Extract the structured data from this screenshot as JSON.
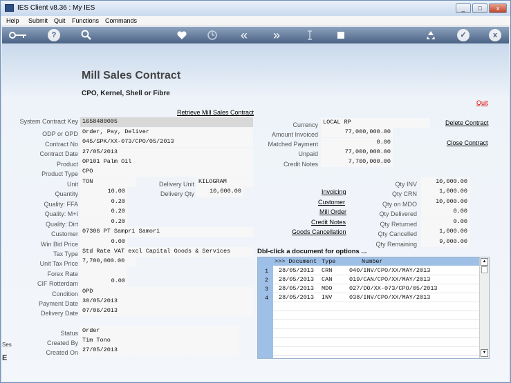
{
  "window": {
    "title": "IES Client v8.36 : My IES",
    "btn_min": "_",
    "btn_max": "□",
    "btn_close": "x"
  },
  "menu": [
    "Help",
    "Submit",
    "Quit",
    "Functions",
    "Commands"
  ],
  "toolbar": {
    "icons": [
      "key-icon",
      "help-icon",
      "search-icon",
      "heart-icon",
      "clock-icon",
      "rewind-icon",
      "forward-icon",
      "text-cursor-icon",
      "stop-icon",
      "recycle-icon",
      "check-icon",
      "close-icon"
    ],
    "help": "?",
    "check": "✓",
    "close": "x",
    "rewind": "«",
    "forward": "»"
  },
  "page": {
    "title": "Mill Sales Contract",
    "subtitle": "CPO, Kernel, Shell or Fibre",
    "quit": "Quit",
    "retrieve": "Retrieve Mill Sales Contract"
  },
  "left_fields": [
    {
      "label": "System Contract Key",
      "value": "1658480005"
    },
    {
      "label": "ODP or OPD",
      "value": "Order, Pay, Deliver"
    },
    {
      "label": "Contract No",
      "value": "045/SPK/XX-073/CPO/05/2013"
    },
    {
      "label": "Contract Date",
      "value": "27/05/2013"
    },
    {
      "label": "Product",
      "value": "OP101 Palm Oil"
    },
    {
      "label": "Product Type",
      "value": "CPO"
    },
    {
      "label": "Unit",
      "value": "TON"
    },
    {
      "label": "Quantity",
      "value": "10.00"
    },
    {
      "label": "Quality: FFA",
      "value": "0.20"
    },
    {
      "label": "Quality: M+I",
      "value": "0.20"
    },
    {
      "label": "Quality: Dirt",
      "value": "0.20"
    },
    {
      "label": "Customer",
      "value": "07306 PT Sampri Samori"
    },
    {
      "label": "Win Bid Price",
      "value": "0.00"
    },
    {
      "label": "Tax Type",
      "value": "Std Rate VAT excl Capital Goods & Services"
    },
    {
      "label": "Unit Tax Price",
      "value": "7,700,000.00"
    },
    {
      "label": "Forex Rate",
      "value": ""
    },
    {
      "label": "CIF Rotterdam",
      "value": "0.00"
    },
    {
      "label": "Condition",
      "value": "OPD"
    },
    {
      "label": "Payment Date",
      "value": "30/05/2013"
    },
    {
      "label": "Delivery Date",
      "value": "07/06/2013"
    }
  ],
  "delivery": {
    "unit_label": "Delivery Unit",
    "unit_value": "KILOGRAM",
    "qty_label": "Delivery Qty",
    "qty_value": "10,000.00"
  },
  "status": [
    {
      "label": "Status",
      "value": "Order"
    },
    {
      "label": "Created By",
      "value": "Tim Tono"
    },
    {
      "label": "Created On",
      "value": "27/05/2013"
    }
  ],
  "finance": [
    {
      "label": "Currency",
      "value": "LOCAL RP"
    },
    {
      "label": "Amount Invoiced",
      "value": "77,000,000.00"
    },
    {
      "label": "Matched Payment",
      "value": "0.00"
    },
    {
      "label": "Unpaid",
      "value": "77,000,000.00"
    },
    {
      "label": "Credit Notes",
      "value": "7,700,000.00"
    }
  ],
  "actions": {
    "delete": "Delete Contract",
    "close": "Close Contract"
  },
  "doc_links": [
    "Invoicing",
    "Customer",
    "Mill Order",
    "Credit Notes",
    "Goods Cancellation"
  ],
  "qty": [
    {
      "label": "Qty INV",
      "value": "10,000.00"
    },
    {
      "label": "Qty CRN",
      "value": "1,000.00"
    },
    {
      "label": "Qty on MDO",
      "value": "10,000.00"
    },
    {
      "label": "Qty Delivered",
      "value": "0.00"
    },
    {
      "label": "Qty Returned",
      "value": "0.00"
    },
    {
      "label": "Qty Cancelled",
      "value": "1,000.00"
    },
    {
      "label": "Qty Remaining",
      "value": "9,000.00"
    }
  ],
  "grid": {
    "header": "Dbl-click a document for options ...",
    "col_doc": ">>> Document",
    "col_type": "Type",
    "col_number": "Number",
    "rows": [
      {
        "n": "1",
        "date": "28/05/2013",
        "type": "CRN",
        "number": "040/INV/CPO/XX/MAY/2013"
      },
      {
        "n": "2",
        "date": "28/05/2013",
        "type": "CAN",
        "number": "019/CAN/CPO/XX/MAY/2013"
      },
      {
        "n": "3",
        "date": "28/05/2013",
        "type": "MDO",
        "number": "027/DO/XX-073/CPO/05/2013"
      },
      {
        "n": "4",
        "date": "28/05/2013",
        "type": "INV",
        "number": "038/INV/CPO/XX/MAY/2013"
      }
    ],
    "scroll_up": "▲",
    "scroll_down": "▼"
  },
  "side_fragments": [
    "Ses",
    "E"
  ]
}
